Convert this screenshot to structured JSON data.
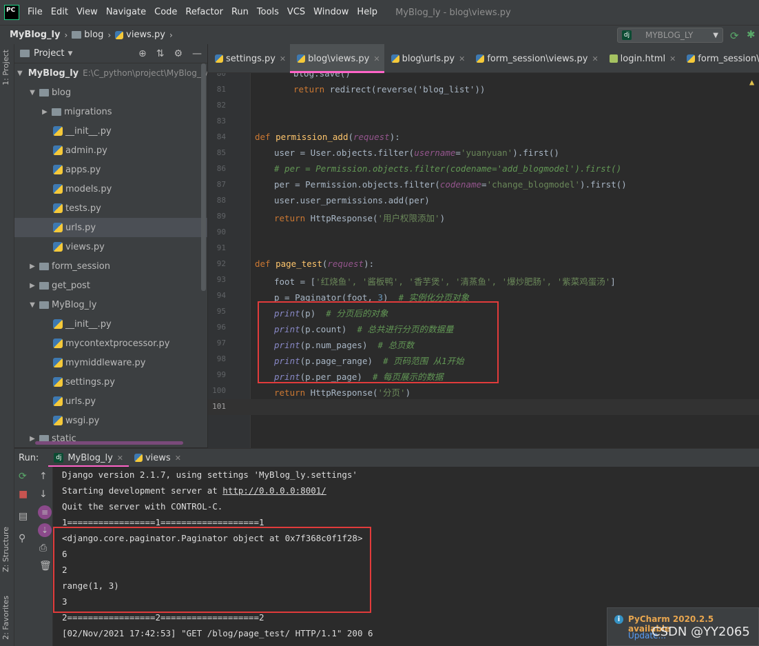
{
  "menu": {
    "items": [
      "File",
      "Edit",
      "View",
      "Navigate",
      "Code",
      "Refactor",
      "Run",
      "Tools",
      "VCS",
      "Window",
      "Help"
    ],
    "window_title": "MyBlog_ly - blog\\views.py",
    "logo": "PC"
  },
  "nav": {
    "crumbs": [
      "MyBlog_ly",
      "blog",
      "views.py"
    ],
    "run_config": "MYBLOG_LY"
  },
  "left_strip": {
    "project": "1: Project",
    "structure": "Z: Structure",
    "favorites": "2: Favorites"
  },
  "project": {
    "title": "Project",
    "root_name": "MyBlog_ly",
    "root_path": "E:\\C_python\\project\\MyBlog_ly",
    "tree": [
      {
        "label": "blog"
      },
      {
        "label": "migrations"
      },
      {
        "label": "__init__.py"
      },
      {
        "label": "admin.py"
      },
      {
        "label": "apps.py"
      },
      {
        "label": "models.py"
      },
      {
        "label": "tests.py"
      },
      {
        "label": "urls.py"
      },
      {
        "label": "views.py"
      },
      {
        "label": "form_session"
      },
      {
        "label": "get_post"
      },
      {
        "label": "MyBlog_ly"
      },
      {
        "label": "__init__.py"
      },
      {
        "label": "mycontextprocessor.py"
      },
      {
        "label": "mymiddleware.py"
      },
      {
        "label": "settings.py"
      },
      {
        "label": "urls.py"
      },
      {
        "label": "wsgi.py"
      },
      {
        "label": "static"
      }
    ]
  },
  "tabs": [
    "settings.py",
    "blog\\views.py",
    "blog\\urls.py",
    "form_session\\views.py",
    "login.html",
    "form_session\\urls.py"
  ],
  "editor": {
    "line_numbers": [
      "80",
      "81",
      "82",
      "83",
      "84",
      "85",
      "86",
      "87",
      "88",
      "89",
      "90",
      "91",
      "92",
      "93",
      "94",
      "95",
      "96",
      "97",
      "98",
      "99",
      "100",
      "101"
    ],
    "lines": {
      "l80": "blog.save()",
      "l81_kw": "return",
      "l81_rest": " redirect(reverse('blog_list'))",
      "l84_def": "def",
      "l84_fn": "permission_add",
      "l84_par": "request",
      "l85_a": "user = User.objects.filter(",
      "l85_par": "username",
      "l85_str": "'yuanyuan'",
      "l85_b": ").first()",
      "l86": "# per = Permission.objects.filter(codename='add_blogmodel').first()",
      "l87_a": "per = Permission.objects.filter(",
      "l87_par": "codename",
      "l87_str": "'change_blogmodel'",
      "l87_b": ").first()",
      "l88": "user.user_permissions.add(per)",
      "l89_kw": "return",
      "l89_a": " HttpResponse(",
      "l89_str": "'用户权限添加'",
      "l89_b": ")",
      "l92_def": "def",
      "l92_fn": "page_test",
      "l92_par": "request",
      "l93_a": "foot = [",
      "l93_str": "'红烧鱼', '酱板鸭', '香芋煲', '清蒸鱼', '爆炒肥肠', '紫菜鸡蛋汤'",
      "l93_b": "]",
      "l94_a": "p = Paginator(foot, ",
      "l94_num": "3",
      "l94_b": ")  ",
      "l94_cm": "# 实例化分页对象",
      "l95_a": "(p)  ",
      "l95_cm": "# 分页后的对象",
      "l96_a": "(p.count)  ",
      "l96_cm": "# 总共进行分页的数据量",
      "l97_a": "(p.num_pages)  ",
      "l97_cm": "# 总页数",
      "l98_a": "(p.page_range)  ",
      "l98_cm": "# 页码范围 从1开始",
      "l99_a": "(p.per_page)  ",
      "l99_cm": "# 每页展示的数据",
      "l100_kw": "return",
      "l100_a": " HttpResponse(",
      "l100_str": "'分页'",
      "l100_b": ")",
      "print": "print"
    }
  },
  "run": {
    "label": "Run:",
    "tabs": [
      "MyBlog_ly",
      "views"
    ],
    "console": [
      "Django version 2.1.7, using settings 'MyBlog_ly.settings'",
      "Starting development server at ",
      "http://0.0.0.0:8001/",
      "Quit the server with CONTROL-C.",
      "1=================1===================1",
      "<django.core.paginator.Paginator object at 0x7f368c0f1f28>",
      "6",
      "2",
      "range(1, 3)",
      "3",
      "2=================2===================2",
      "[02/Nov/2021 17:42:53] \"GET /blog/page_test/ HTTP/1.1\" 200 6"
    ]
  },
  "notification": {
    "title": "PyCharm 2020.2.5 available",
    "link": "Update..."
  },
  "watermark": "CSDN @YY2065",
  "colors": {
    "accent": "#ff64c8",
    "highlight_box": "#e23b3b"
  }
}
